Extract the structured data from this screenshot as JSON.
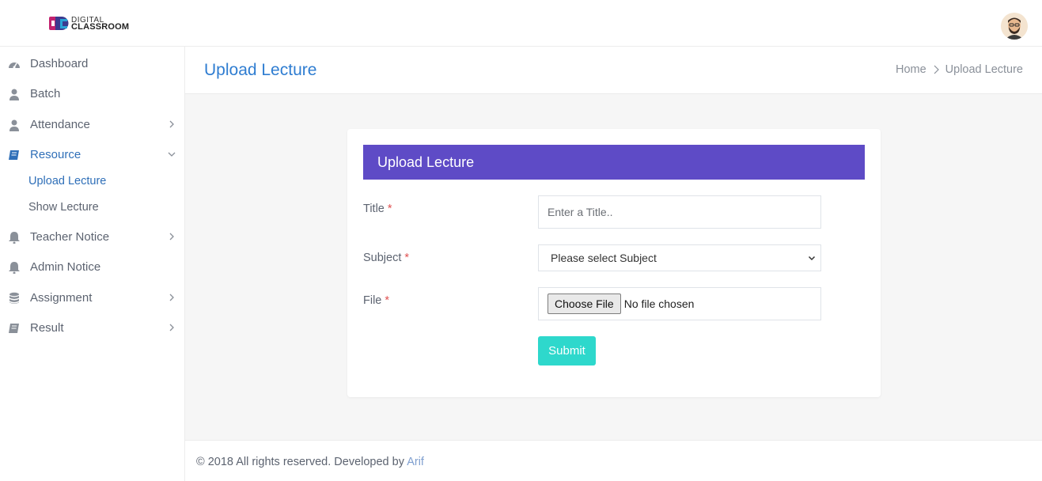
{
  "brand": {
    "line1": "DIGITAL",
    "line2": "CLASSROOM"
  },
  "sidebar": {
    "items": [
      {
        "label": "Dashboard",
        "icon": "dashboard-icon"
      },
      {
        "label": "Batch",
        "icon": "user-icon"
      },
      {
        "label": "Attendance",
        "icon": "user-icon",
        "chevron": "right"
      },
      {
        "label": "Resource",
        "icon": "book-icon",
        "chevron": "down",
        "active": true
      },
      {
        "label": "Teacher Notice",
        "icon": "bell-icon",
        "chevron": "right"
      },
      {
        "label": "Admin Notice",
        "icon": "bell-icon"
      },
      {
        "label": "Assignment",
        "icon": "database-icon",
        "chevron": "right"
      },
      {
        "label": "Result",
        "icon": "book-icon",
        "chevron": "right"
      }
    ],
    "resource_sub": [
      {
        "label": "Upload Lecture",
        "active": true
      },
      {
        "label": "Show Lecture"
      }
    ]
  },
  "page": {
    "title": "Upload Lecture",
    "breadcrumb": {
      "home": "Home",
      "current": "Upload Lecture"
    }
  },
  "form": {
    "header": "Upload Lecture",
    "title_label": "Title",
    "title_placeholder": "Enter a Title..",
    "subject_label": "Subject",
    "subject_selected": "Please select Subject",
    "file_label": "File",
    "file_button": "Choose File",
    "file_status": "No file chosen",
    "required_mark": "*",
    "submit": "Submit"
  },
  "footer": {
    "text": "© 2018 All rights reserved. Developed by ",
    "author": "Arif"
  },
  "colors": {
    "accent": "#2f7dd1",
    "card_header": "#5e4bc6",
    "submit": "#2ed8cc",
    "required": "#e05252"
  }
}
